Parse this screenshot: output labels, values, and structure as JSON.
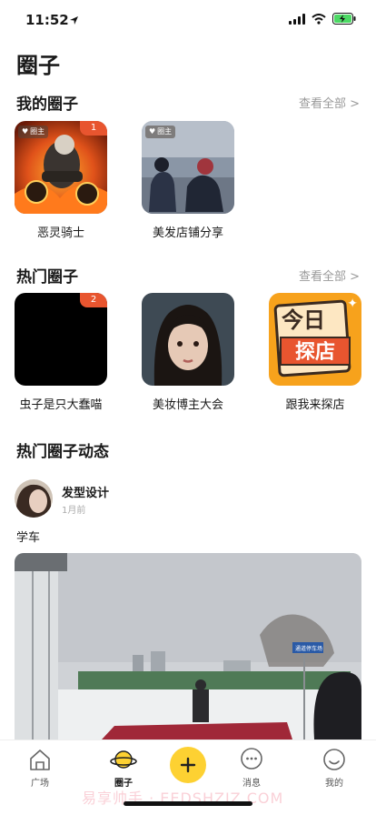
{
  "status_bar": {
    "time": "11:52"
  },
  "page": {
    "title": "圈子"
  },
  "my_circles": {
    "title": "我的圈子",
    "view_all": "查看全部 >",
    "items": [
      {
        "label": "恶灵骑士",
        "owner_tag": "圈主",
        "badge": "1"
      },
      {
        "label": "美发店铺分享",
        "owner_tag": "圈主"
      }
    ]
  },
  "hot_circles": {
    "title": "热门圈子",
    "view_all": "查看全部 >",
    "items": [
      {
        "label": "虫子是只大蠢喵",
        "badge": "2"
      },
      {
        "label": "美妆博主大会"
      },
      {
        "label": "跟我来探店",
        "image_text_top": "今日",
        "image_text_bottom": "探店"
      }
    ]
  },
  "hot_feed": {
    "title": "热门圈子动态",
    "post": {
      "user_name": "发型设计",
      "time": "1月前",
      "text": "学车",
      "image_sign_text": "通道停车场"
    }
  },
  "tab_bar": {
    "tabs": [
      {
        "label": "广场",
        "icon": "house-icon"
      },
      {
        "label": "圈子",
        "icon": "planet-icon",
        "active": true
      },
      {
        "label": "",
        "icon": "plus-icon"
      },
      {
        "label": "消息",
        "icon": "chat-bubble-icon"
      },
      {
        "label": "我的",
        "icon": "smiley-icon"
      }
    ]
  },
  "watermark": "易享帅手 · EEDSHZIZ.COM",
  "colors": {
    "accent": "#fdd132",
    "badge": "#e8552f",
    "muted": "#9a9a9a"
  }
}
